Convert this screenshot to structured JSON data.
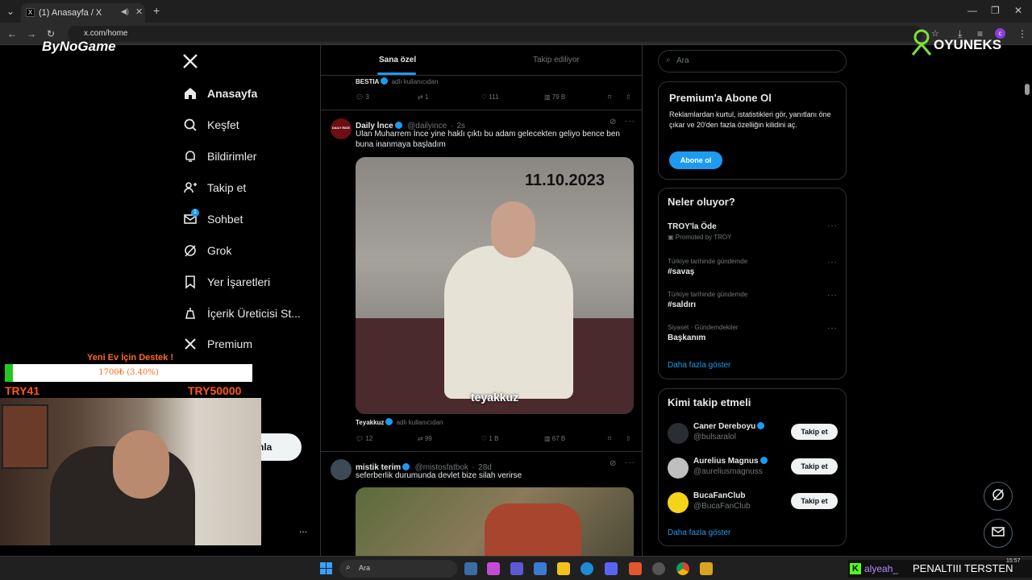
{
  "browser": {
    "tab_title": "(1) Anasayfa / X",
    "url": "x.com/home"
  },
  "overlay": {
    "bynogame": "ByNoGame",
    "oyuneks": "OYUNEKS",
    "donation_title": "Yeni Ev İçin Destek !",
    "donation_amount": "1700₺ (3.40%)",
    "donation_progress": 0.034,
    "donation_min": "TRY41",
    "donation_max": "TRY50000",
    "ticker_user": "alyeah_",
    "ticker_text": "PENALTIII TERSTEN"
  },
  "nav": {
    "items": [
      {
        "label": "Anasayfa",
        "icon": "home-icon"
      },
      {
        "label": "Keşfet",
        "icon": "search-icon"
      },
      {
        "label": "Bildirimler",
        "icon": "bell-icon"
      },
      {
        "label": "Takip et",
        "icon": "person-add-icon"
      },
      {
        "label": "Sohbet",
        "icon": "mail-icon"
      },
      {
        "label": "Grok",
        "icon": "grok-icon"
      },
      {
        "label": "Yer İşaretleri",
        "icon": "bookmark-icon"
      },
      {
        "label": "İçerik Üreticisi St...",
        "icon": "creator-icon"
      },
      {
        "label": "Premium",
        "icon": "x-icon"
      }
    ],
    "notification_badge": "1",
    "post_button_partial": "nla",
    "more": "..."
  },
  "feed": {
    "tabs": [
      "Sana özel",
      "Takip ediliyor"
    ],
    "prev_tweet": {
      "source": "BESTIA",
      "source_note": "adlı kullanıcıdan",
      "replies": "3",
      "retweets": "1",
      "likes": "111",
      "views": "79 B"
    },
    "tweets": [
      {
        "name": "Daily İnce",
        "handle": "@dailyince",
        "time": "2s",
        "avatar": "DAILY İNCE",
        "text": "Ulan Muharrem İnce yine haklı çıktı bu adam gelecekten geliyo bence ben buna inanmaya başladım",
        "media_date": "11.10.2023",
        "media_watermark": "teyakkuz",
        "source": "Teyakkuz",
        "source_note": "adlı kullanıcıdan",
        "replies": "12",
        "retweets": "99",
        "likes": "1 B",
        "views": "67 B"
      },
      {
        "name": "mistik terim",
        "handle": "@mistosfatbok",
        "time": "28d",
        "text": "seferberlik durumunda devlet bize silah verirse"
      }
    ]
  },
  "sidebar": {
    "search_placeholder": "Ara",
    "premium": {
      "title": "Premium'a Abone Ol",
      "desc": "Reklamlardan kurtul, istatistikleri gör, yanıtlanı öne çıkar ve 20'den fazla özelliğin kilidini aç.",
      "button": "Abone ol"
    },
    "trends": {
      "title": "Neler oluyor?",
      "items": [
        {
          "name": "TROY'la Öde",
          "context": "Promoted by TROY"
        },
        {
          "context": "Türkiye tarihinde gündemde",
          "name": "#savaş"
        },
        {
          "context": "Türkiye tarihinde gündemde",
          "name": "#saldırı"
        },
        {
          "context": "Siyaset · Gündemdekiler",
          "name": "Başkanım"
        }
      ],
      "show_more": "Daha fazla göster"
    },
    "follow": {
      "title": "Kimi takip etmeli",
      "users": [
        {
          "name": "Caner Dereboyu",
          "handle": "@bulsaralol",
          "button": "Takip et"
        },
        {
          "name": "Aurelius Magnus",
          "handle": "@aureliusmagnuss",
          "button": "Takip et"
        },
        {
          "name": "BucaFanClub",
          "handle": "@BucaFanClub",
          "button": "Takip et"
        }
      ],
      "show_more": "Daha fazla göster"
    }
  },
  "taskbar": {
    "search": "Ara",
    "time": "15:57"
  }
}
